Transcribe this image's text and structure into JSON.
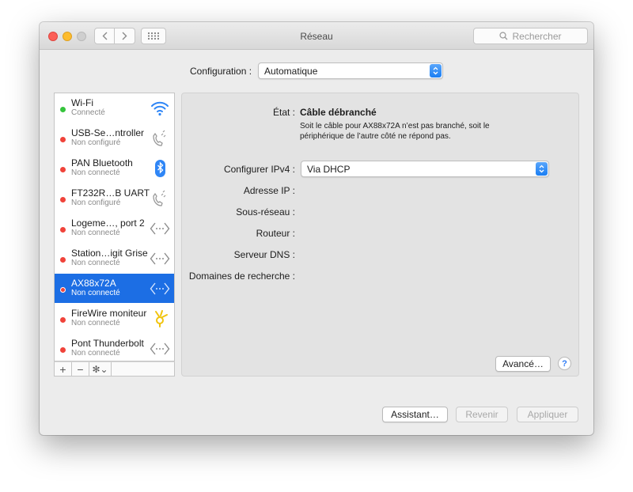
{
  "window": {
    "title": "Réseau",
    "search_placeholder": "Rechercher"
  },
  "configuration": {
    "label": "Configuration :",
    "value": "Automatique"
  },
  "services": [
    {
      "name": "Wi-Fi",
      "status": "Connecté",
      "dot": "green",
      "icon": "wifi-icon"
    },
    {
      "name": "USB-Se…ntroller",
      "status": "Non configuré",
      "dot": "red",
      "icon": "phone-icon"
    },
    {
      "name": "PAN Bluetooth",
      "status": "Non connecté",
      "dot": "red",
      "icon": "bluetooth-icon"
    },
    {
      "name": "FT232R…B UART",
      "status": "Non configuré",
      "dot": "red",
      "icon": "phone-icon"
    },
    {
      "name": "Logeme…, port 2",
      "status": "Non connecté",
      "dot": "red",
      "icon": "ethernet-icon"
    },
    {
      "name": "Station…igit Grise",
      "status": "Non connecté",
      "dot": "red",
      "icon": "ethernet-icon"
    },
    {
      "name": "AX88x72A",
      "status": "Non connecté",
      "dot": "red",
      "icon": "ethernet-icon",
      "selected": true
    },
    {
      "name": "FireWire moniteur",
      "status": "Non connecté",
      "dot": "red",
      "icon": "firewire-icon"
    },
    {
      "name": "Pont Thunderbolt",
      "status": "Non connecté",
      "dot": "red",
      "icon": "ethernet-icon"
    }
  ],
  "detail": {
    "state_label": "État :",
    "state_value": "Câble débranché",
    "state_desc": "Soit le câble pour AX88x72A n’est pas branché, soit le périphérique de l’autre côté ne répond pas.",
    "ipv4_label": "Configurer IPv4 :",
    "ipv4_value": "Via DHCP",
    "ip_label": "Adresse IP :",
    "subnet_label": "Sous-réseau :",
    "router_label": "Routeur :",
    "dns_label": "Serveur DNS :",
    "search_domains_label": "Domaines de recherche :",
    "advanced_button": "Avancé…",
    "help": "?"
  },
  "footer": {
    "assistant": "Assistant…",
    "revert": "Revenir",
    "apply": "Appliquer"
  },
  "toolbar": {
    "add": "+",
    "remove": "−",
    "gear": "✻⌄"
  },
  "colors": {
    "selection": "#1c6ee4",
    "accent_popup": "#1a7ef3",
    "status_green": "#36c43c",
    "status_red": "#f0433a"
  }
}
